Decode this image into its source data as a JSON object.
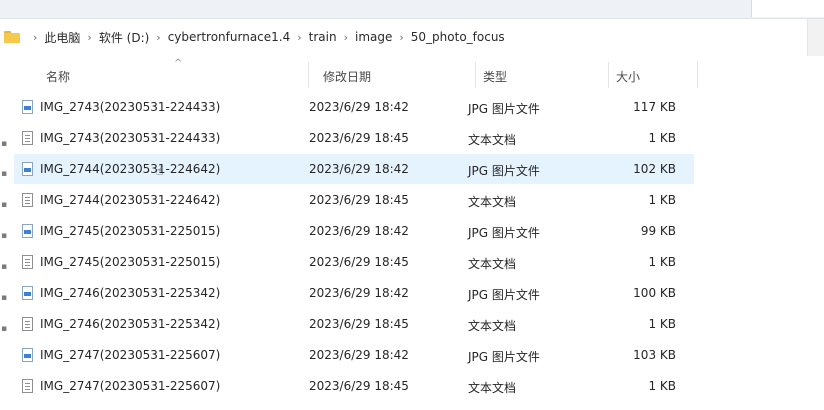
{
  "breadcrumb": {
    "folder_icon": "folder-icon",
    "items": [
      "此电脑",
      "软件 (D:)",
      "cybertronfurnace1.4",
      "train",
      "image",
      "50_photo_focus"
    ]
  },
  "columns": {
    "name": "名称",
    "date": "修改日期",
    "type": "类型",
    "size": "大小"
  },
  "files": [
    {
      "name": "IMG_2743(20230531-224433)",
      "date": "2023/6/29 18:42",
      "type": "JPG 图片文件",
      "size": "117 KB",
      "icon": "jpg-file-icon"
    },
    {
      "name": "IMG_2743(20230531-224433)",
      "date": "2023/6/29 18:45",
      "type": "文本文档",
      "size": "1 KB",
      "icon": "text-file-icon"
    },
    {
      "name": "IMG_2744(20230531-224642)",
      "date": "2023/6/29 18:42",
      "type": "JPG 图片文件",
      "size": "102 KB",
      "icon": "jpg-file-icon"
    },
    {
      "name": "IMG_2744(20230531-224642)",
      "date": "2023/6/29 18:45",
      "type": "文本文档",
      "size": "1 KB",
      "icon": "text-file-icon"
    },
    {
      "name": "IMG_2745(20230531-225015)",
      "date": "2023/6/29 18:42",
      "type": "JPG 图片文件",
      "size": "99 KB",
      "icon": "jpg-file-icon"
    },
    {
      "name": "IMG_2745(20230531-225015)",
      "date": "2023/6/29 18:45",
      "type": "文本文档",
      "size": "1 KB",
      "icon": "text-file-icon"
    },
    {
      "name": "IMG_2746(20230531-225342)",
      "date": "2023/6/29 18:42",
      "type": "JPG 图片文件",
      "size": "100 KB",
      "icon": "jpg-file-icon"
    },
    {
      "name": "IMG_2746(20230531-225342)",
      "date": "2023/6/29 18:45",
      "type": "文本文档",
      "size": "1 KB",
      "icon": "text-file-icon"
    },
    {
      "name": "IMG_2747(20230531-225607)",
      "date": "2023/6/29 18:42",
      "type": "JPG 图片文件",
      "size": "103 KB",
      "icon": "jpg-file-icon"
    },
    {
      "name": "IMG_2747(20230531-225607)",
      "date": "2023/6/29 18:45",
      "type": "文本文档",
      "size": "1 KB",
      "icon": "text-file-icon"
    }
  ],
  "hover_row": 2,
  "colors": {
    "hover_bg": "#e5f3ff",
    "folder": "#f4c94c"
  }
}
